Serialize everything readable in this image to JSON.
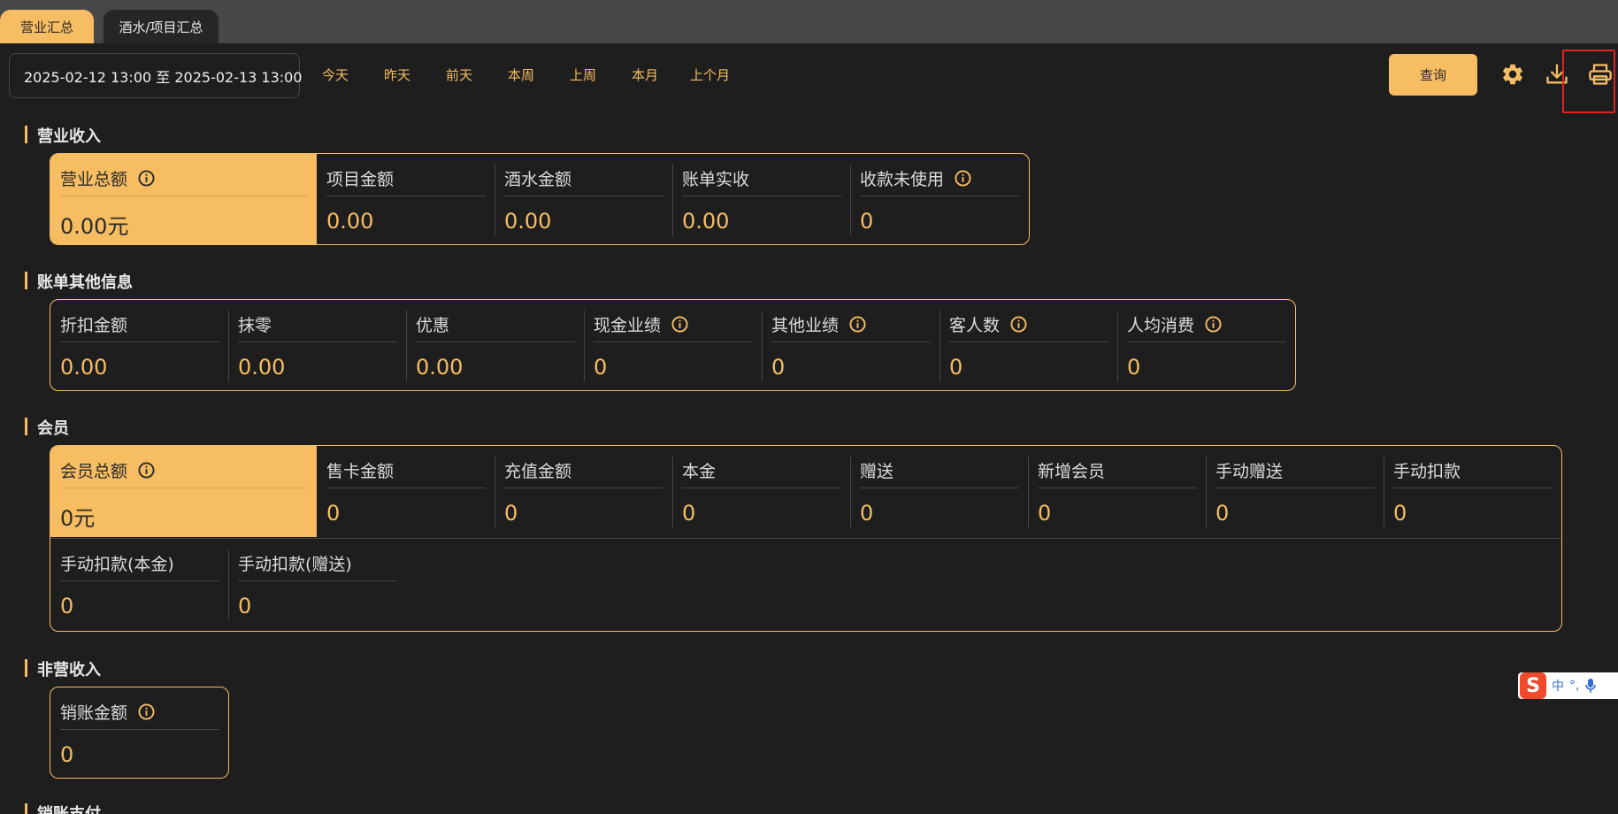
{
  "tabs": [
    {
      "label": "营业汇总",
      "active": true
    },
    {
      "label": "酒水/项目汇总",
      "active": false
    }
  ],
  "filter": {
    "date_range": "2025-02-12 13:00 至 2025-02-13 13:00",
    "quick_ranges": [
      "今天",
      "昨天",
      "前天",
      "本周",
      "上周",
      "本月",
      "上个月"
    ],
    "query_label": "查询"
  },
  "toolbar_icons": [
    "gear-icon",
    "download-icon",
    "printer-icon"
  ],
  "sections": {
    "revenue": {
      "title": "营业收入",
      "items": [
        {
          "label": "营业总额",
          "value": "0.00元",
          "info": true
        },
        {
          "label": "项目金额",
          "value": "0.00"
        },
        {
          "label": "酒水金额",
          "value": "0.00"
        },
        {
          "label": "账单实收",
          "value": "0.00"
        },
        {
          "label": "收款未使用",
          "value": "0",
          "info": true
        }
      ]
    },
    "other": {
      "title": "账单其他信息",
      "items": [
        {
          "label": "折扣金额",
          "value": "0.00"
        },
        {
          "label": "抹零",
          "value": "0.00"
        },
        {
          "label": "优惠",
          "value": "0.00"
        },
        {
          "label": "现金业绩",
          "value": "0",
          "info": true
        },
        {
          "label": "其他业绩",
          "value": "0",
          "info": true
        },
        {
          "label": "客人数",
          "value": "0",
          "info": true
        },
        {
          "label": "人均消费",
          "value": "0",
          "info": true
        }
      ]
    },
    "member": {
      "title": "会员",
      "items": [
        {
          "label": "会员总额",
          "value": "0元",
          "info": true
        },
        {
          "label": "售卡金额",
          "value": "0"
        },
        {
          "label": "充值金额",
          "value": "0"
        },
        {
          "label": "本金",
          "value": "0"
        },
        {
          "label": "赠送",
          "value": "0"
        },
        {
          "label": "新增会员",
          "value": "0"
        },
        {
          "label": "手动赠送",
          "value": "0"
        },
        {
          "label": "手动扣款",
          "value": "0"
        },
        {
          "label": "手动扣款(本金)",
          "value": "0"
        },
        {
          "label": "手动扣款(赠送)",
          "value": "0"
        }
      ]
    },
    "non_operating": {
      "title": "非营收入",
      "items": [
        {
          "label": "销账金额",
          "value": "0",
          "info": true
        }
      ]
    },
    "writeoff": {
      "title": "销账支付"
    }
  },
  "ime": {
    "lang": "中"
  },
  "colors": {
    "accent": "#f6bd62",
    "background": "#1e1e1e",
    "tabbar": "#474747",
    "highlight": "#e52121"
  }
}
